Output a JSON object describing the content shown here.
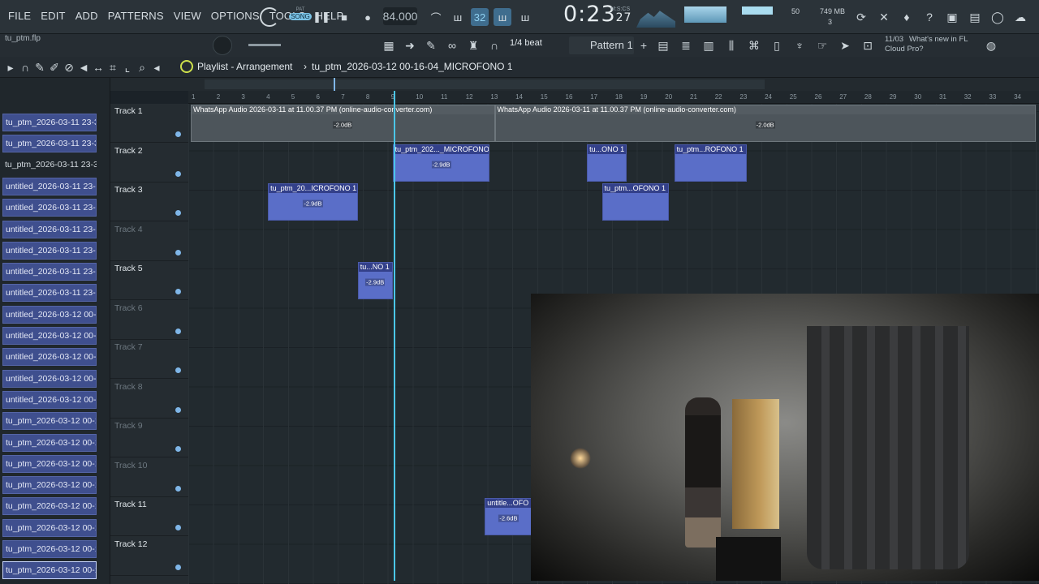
{
  "menu": [
    "FILE",
    "EDIT",
    "ADD",
    "PATTERNS",
    "VIEW",
    "OPTIONS",
    "TOOLS",
    "HELP"
  ],
  "transport": {
    "pat_label": "PAT",
    "song_label": "SONG",
    "tempo": "84.000",
    "beats": "32",
    "time": "0:23",
    "time_small": "27",
    "mcs": "M:S:CS"
  },
  "monitor": {
    "cpu_value": "50",
    "memory": "749 MB",
    "polyphony": "3"
  },
  "news": {
    "date": "11/03",
    "text": "What's new in FL Cloud Pro?"
  },
  "project_file": "tu_ptm.flp",
  "snap": "1/4 beat",
  "pattern": "Pattern 1",
  "playlist_title": "Playlist - Arrangement",
  "breadcrumb_clip": "tu_ptm_2026-03-12 00-16-04_MICROFONO 1",
  "browser_items": [
    {
      "label": "tu_ptm_2026-03-11 23-3...",
      "style": "blue"
    },
    {
      "label": "tu_ptm_2026-03-11 23-3...",
      "style": "blue"
    },
    {
      "label": "tu_ptm_2026-03-11 23-3...",
      "style": "plain"
    },
    {
      "label": "untitled_2026-03-11 23-...",
      "style": "blue"
    },
    {
      "label": "untitled_2026-03-11 23-...",
      "style": "blue"
    },
    {
      "label": "untitled_2026-03-11 23-...",
      "style": "blue"
    },
    {
      "label": "untitled_2026-03-11 23-...",
      "style": "blue"
    },
    {
      "label": "untitled_2026-03-11 23-...",
      "style": "blue"
    },
    {
      "label": "untitled_2026-03-11 23-...",
      "style": "blue"
    },
    {
      "label": "untitled_2026-03-12 00-...",
      "style": "blue"
    },
    {
      "label": "untitled_2026-03-12 00-...",
      "style": "blue"
    },
    {
      "label": "untitled_2026-03-12 00-...",
      "style": "blue"
    },
    {
      "label": "untitled_2026-03-12 00-...",
      "style": "blue"
    },
    {
      "label": "untitled_2026-03-12 00-...",
      "style": "blue"
    },
    {
      "label": "tu_ptm_2026-03-12 00-1...",
      "style": "blue"
    },
    {
      "label": "tu_ptm_2026-03-12 00-1...",
      "style": "blue"
    },
    {
      "label": "tu_ptm_2026-03-12 00-1...",
      "style": "blue"
    },
    {
      "label": "tu_ptm_2026-03-12 00-1...",
      "style": "blue"
    },
    {
      "label": "tu_ptm_2026-03-12 00-1...",
      "style": "blue"
    },
    {
      "label": "tu_ptm_2026-03-12 00-1...",
      "style": "blue"
    },
    {
      "label": "tu_ptm_2026-03-12 00-1...",
      "style": "blue"
    },
    {
      "label": "tu_ptm_2026-03-12 00-1...",
      "style": "selected"
    }
  ],
  "tracks": [
    {
      "name": "Track 1",
      "active": true
    },
    {
      "name": "Track 2",
      "active": true
    },
    {
      "name": "Track 3",
      "active": true
    },
    {
      "name": "Track 4",
      "active": false
    },
    {
      "name": "Track 5",
      "active": true
    },
    {
      "name": "Track 6",
      "active": false
    },
    {
      "name": "Track 7",
      "active": false
    },
    {
      "name": "Track 8",
      "active": false
    },
    {
      "name": "Track 9",
      "active": false
    },
    {
      "name": "Track 10",
      "active": false
    },
    {
      "name": "Track 11",
      "active": true
    },
    {
      "name": "Track 12",
      "active": true
    }
  ],
  "ruler": [
    "1",
    "2",
    "3",
    "4",
    "5",
    "6",
    "7",
    "8",
    "9",
    "10",
    "11",
    "12",
    "13",
    "14",
    "15",
    "16",
    "17",
    "18",
    "19",
    "20",
    "21",
    "22",
    "23",
    "24",
    "25",
    "26",
    "27",
    "28",
    "29",
    "30",
    "31",
    "32",
    "33",
    "34"
  ],
  "clips": [
    {
      "title": "WhatsApp Audio 2026-03-11 at 11.00.37 PM (online-audio-converter.com)",
      "gain": "-2.0dB",
      "track": 1,
      "bar_start": 1,
      "bar_end": 13.2,
      "style": "gray"
    },
    {
      "title": "WhatsApp Audio 2026-03-11 at 11.00.37 PM (online-audio-converter.com)",
      "gain": "-2.0dB",
      "track": 1,
      "bar_start": 13.2,
      "bar_end": 34.9,
      "style": "gray"
    },
    {
      "title": "tu_ptm_202..._MICROFONO 1",
      "gain": "-2.9dB",
      "track": 2,
      "bar_start": 9.1,
      "bar_end": 13,
      "style": "blue"
    },
    {
      "title": "tu...ONO 1",
      "gain": "",
      "track": 2,
      "bar_start": 16.9,
      "bar_end": 18.5,
      "style": "blue"
    },
    {
      "title": "tu_ptm...ROFONO 1",
      "gain": "",
      "track": 2,
      "bar_start": 20.4,
      "bar_end": 23.3,
      "style": "blue"
    },
    {
      "title": "tu_ptm_20...ICROFONO 1",
      "gain": "-2.9dB",
      "track": 3,
      "bar_start": 4.1,
      "bar_end": 7.7,
      "style": "blue"
    },
    {
      "title": "tu_ptm...OFONO 1",
      "gain": "",
      "track": 3,
      "bar_start": 17.5,
      "bar_end": 20.2,
      "style": "blue"
    },
    {
      "title": "tu...NO 1",
      "gain": "-2.9dB",
      "track": 5,
      "bar_start": 7.7,
      "bar_end": 9.1,
      "style": "blue"
    },
    {
      "title": "untitle...OFO",
      "gain": "-2.6dB",
      "track": 11,
      "bar_start": 12.8,
      "bar_end": 14.7,
      "style": "blue"
    }
  ]
}
